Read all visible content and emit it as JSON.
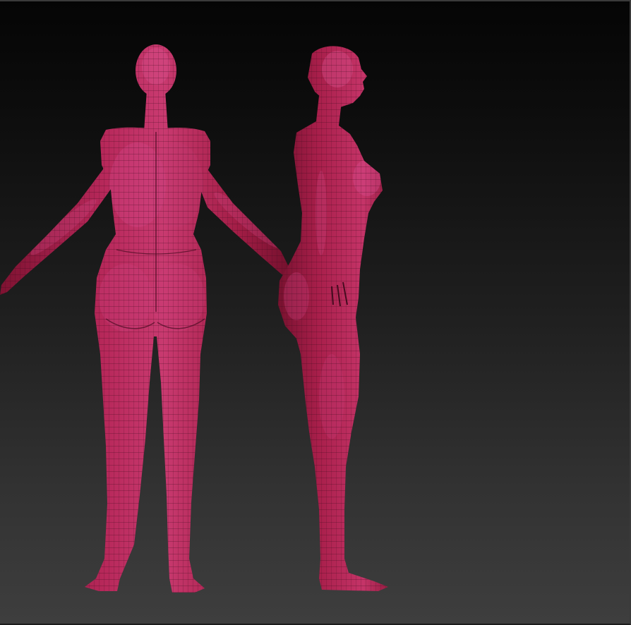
{
  "canvas": {
    "background_top": "#050505",
    "background_bottom": "#3e3e3e"
  },
  "models": [
    {
      "name": "female-base-mesh-back-view",
      "view": "back",
      "material_color": "#a61f45",
      "highlight_color": "#d84c86",
      "wireframe_color": "#3a0a1c"
    },
    {
      "name": "female-base-mesh-side-view",
      "view": "side",
      "material_color": "#a61f45",
      "highlight_color": "#d84c86",
      "wireframe_color": "#3a0a1c"
    }
  ]
}
